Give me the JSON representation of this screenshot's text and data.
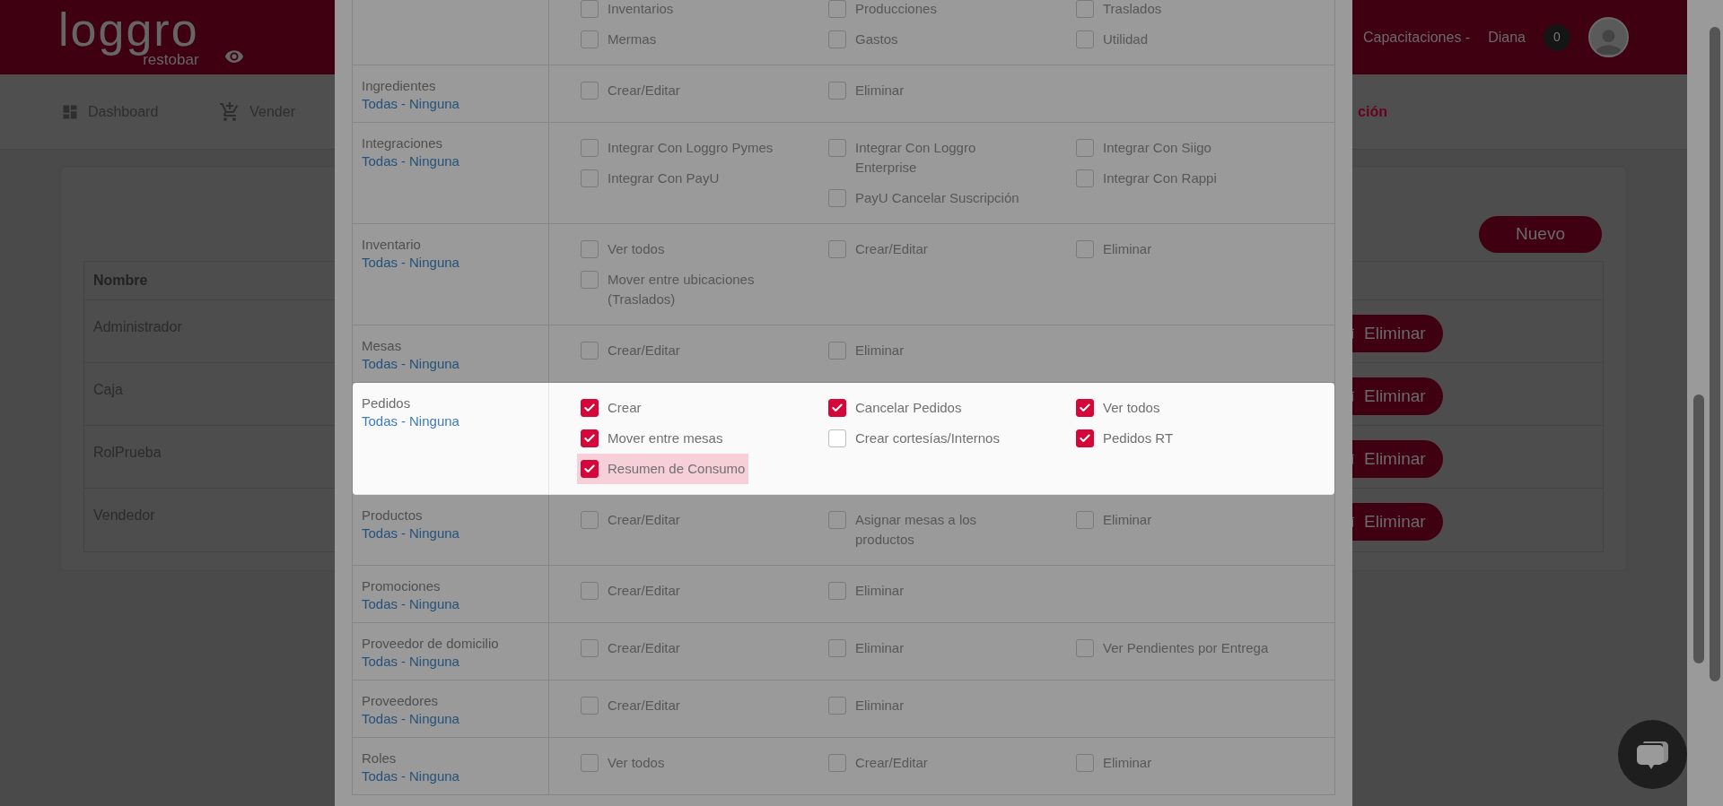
{
  "header": {
    "logo_text": "loggro",
    "logo_subtext": "restobar",
    "org": "Capacitaciones -",
    "user": "Diana",
    "notifications": "0"
  },
  "nav": [
    {
      "label": "Dashboard",
      "selected": false
    },
    {
      "label": "Vender",
      "selected": false
    },
    {
      "label": "ción",
      "selected": true
    }
  ],
  "page": {
    "new_button": "Nuevo",
    "table": {
      "columns": [
        "Nombre"
      ],
      "rows": [
        {
          "name": "Administrador",
          "action": "Eliminar"
        },
        {
          "name": "Caja",
          "action": "Eliminar"
        },
        {
          "name": "RolPrueba",
          "action": "Eliminar"
        },
        {
          "name": "Vendedor",
          "action": "Eliminar"
        }
      ]
    }
  },
  "modal": {
    "sections": [
      {
        "spotlight": false,
        "columns": [
          [
            {
              "label": "Inventarios",
              "checked": false,
              "highlighted": false
            },
            {
              "label": "Mermas",
              "checked": false,
              "highlighted": false
            }
          ],
          [
            {
              "label": "Producciones",
              "checked": false,
              "highlighted": false
            },
            {
              "label": "Gastos",
              "checked": false,
              "highlighted": false
            }
          ],
          [
            {
              "label": "Traslados",
              "checked": false,
              "highlighted": false
            },
            {
              "label": "Utilidad",
              "checked": false,
              "highlighted": false
            }
          ]
        ]
      },
      {
        "name": "Ingredientes",
        "all": "Todas",
        "separator": "-",
        "none": "Ninguna",
        "spotlight": false,
        "columns": [
          [
            {
              "label": "Crear/Editar",
              "checked": false,
              "highlighted": false
            }
          ],
          [
            {
              "label": "Eliminar",
              "checked": false,
              "highlighted": false
            }
          ],
          []
        ]
      },
      {
        "name": "Integraciones",
        "all": "Todas",
        "separator": "-",
        "none": "Ninguna",
        "spotlight": false,
        "columns": [
          [
            {
              "label": "Integrar Con Loggro Pymes",
              "checked": false,
              "highlighted": false
            },
            {
              "label": "Integrar Con PayU",
              "checked": false,
              "highlighted": false
            }
          ],
          [
            {
              "label": "Integrar Con Loggro Enterprise",
              "checked": false,
              "highlighted": false
            },
            {
              "label": "PayU Cancelar Suscripción",
              "checked": false,
              "highlighted": false
            }
          ],
          [
            {
              "label": "Integrar Con Siigo",
              "checked": false,
              "highlighted": false
            },
            {
              "label": "Integrar Con Rappi",
              "checked": false,
              "highlighted": false
            }
          ]
        ]
      },
      {
        "name": "Inventario",
        "all": "Todas",
        "separator": "-",
        "none": "Ninguna",
        "spotlight": false,
        "columns": [
          [
            {
              "label": "Ver todos",
              "checked": false,
              "highlighted": false
            },
            {
              "label": "Mover entre ubicaciones (Traslados)",
              "checked": false,
              "highlighted": false
            }
          ],
          [
            {
              "label": "Crear/Editar",
              "checked": false,
              "highlighted": false
            }
          ],
          [
            {
              "label": "Eliminar",
              "checked": false,
              "highlighted": false
            }
          ]
        ]
      },
      {
        "name": "Mesas",
        "all": "Todas",
        "separator": "-",
        "none": "Ninguna",
        "spotlight": false,
        "columns": [
          [
            {
              "label": "Crear/Editar",
              "checked": false,
              "highlighted": false
            }
          ],
          [
            {
              "label": "Eliminar",
              "checked": false,
              "highlighted": false
            }
          ],
          []
        ]
      },
      {
        "name": "Pedidos",
        "all": "Todas",
        "separator": "-",
        "none": "Ninguna",
        "spotlight": true,
        "columns": [
          [
            {
              "label": "Crear",
              "checked": true,
              "highlighted": false
            },
            {
              "label": "Mover entre mesas",
              "checked": true,
              "highlighted": false
            },
            {
              "label": "Resumen de Consumo",
              "checked": true,
              "highlighted": true
            }
          ],
          [
            {
              "label": "Cancelar Pedidos",
              "checked": true,
              "highlighted": false
            },
            {
              "label": "Crear cortesías/Internos",
              "checked": false,
              "highlighted": false
            }
          ],
          [
            {
              "label": "Ver todos",
              "checked": true,
              "highlighted": false
            },
            {
              "label": "Pedidos RT",
              "checked": true,
              "highlighted": false
            }
          ]
        ]
      },
      {
        "name": "Productos",
        "all": "Todas",
        "separator": "-",
        "none": "Ninguna",
        "spotlight": false,
        "columns": [
          [
            {
              "label": "Crear/Editar",
              "checked": false,
              "highlighted": false
            }
          ],
          [
            {
              "label": "Asignar mesas a los productos",
              "checked": false,
              "highlighted": false
            }
          ],
          [
            {
              "label": "Eliminar",
              "checked": false,
              "highlighted": false
            }
          ]
        ]
      },
      {
        "name": "Promociones",
        "all": "Todas",
        "separator": "-",
        "none": "Ninguna",
        "spotlight": false,
        "columns": [
          [
            {
              "label": "Crear/Editar",
              "checked": false,
              "highlighted": false
            }
          ],
          [
            {
              "label": "Eliminar",
              "checked": false,
              "highlighted": false
            }
          ],
          []
        ]
      },
      {
        "name": "Proveedor de domicilio",
        "all": "Todas",
        "separator": "-",
        "none": "Ninguna",
        "spotlight": false,
        "columns": [
          [
            {
              "label": "Crear/Editar",
              "checked": false,
              "highlighted": false
            }
          ],
          [
            {
              "label": "Eliminar",
              "checked": false,
              "highlighted": false
            }
          ],
          [
            {
              "label": "Ver Pendientes por Entrega",
              "checked": false,
              "highlighted": false
            }
          ]
        ]
      },
      {
        "name": "Proveedores",
        "all": "Todas",
        "separator": "-",
        "none": "Ninguna",
        "spotlight": false,
        "columns": [
          [
            {
              "label": "Crear/Editar",
              "checked": false,
              "highlighted": false
            }
          ],
          [
            {
              "label": "Eliminar",
              "checked": false,
              "highlighted": false
            }
          ],
          []
        ]
      },
      {
        "name": "Roles",
        "all": "Todas",
        "separator": "-",
        "none": "Ninguna",
        "spotlight": false,
        "columns": [
          [
            {
              "label": "Ver todos",
              "checked": false,
              "highlighted": false
            }
          ],
          [
            {
              "label": "Crear/Editar",
              "checked": false,
              "highlighted": false
            }
          ],
          [
            {
              "label": "Eliminar",
              "checked": false,
              "highlighted": false
            }
          ]
        ]
      }
    ]
  }
}
